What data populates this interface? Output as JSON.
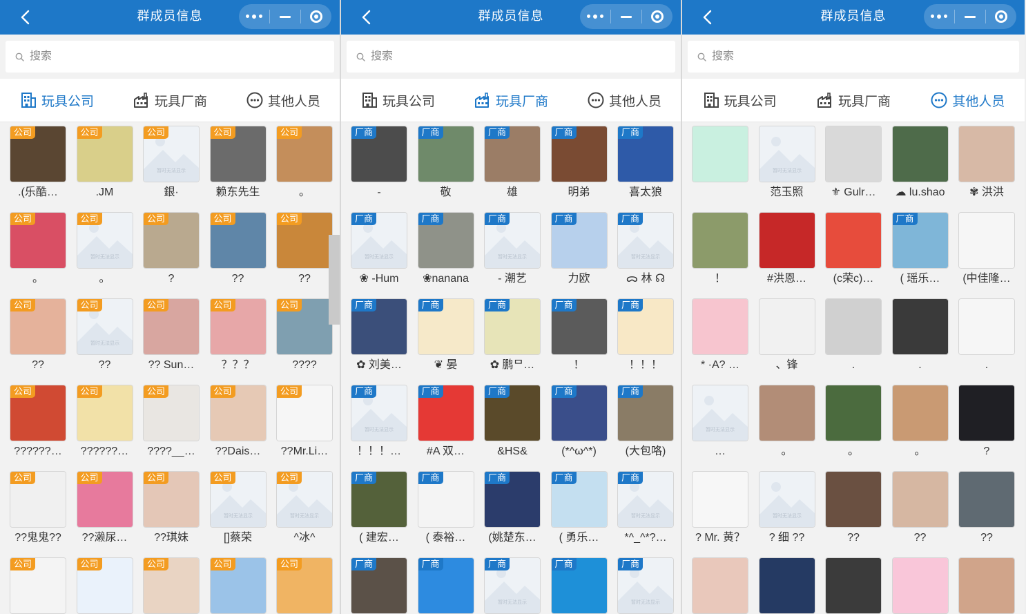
{
  "screens": [
    {
      "title": "群成员信息",
      "search_placeholder": "搜索",
      "tabs": [
        "玩具公司",
        "玩具厂商",
        "其他人员"
      ],
      "active_tab": 0,
      "badge_label": "公司",
      "members": [
        {
          "name": ".(乐酷…",
          "color": "#5a4632"
        },
        {
          "name": ".JM",
          "color": "#d9cf8a"
        },
        {
          "name": "銀·",
          "color": "",
          "placeholder": true
        },
        {
          "name": "赖东先生",
          "color": "#6b6b6b"
        },
        {
          "name": "。",
          "color": "#c48e5b"
        },
        {
          "name": "。",
          "color": "#d94f64"
        },
        {
          "name": "。",
          "color": "",
          "placeholder": true
        },
        {
          "name": "?",
          "color": "#b9a98f"
        },
        {
          "name": "??",
          "color": "#5f86a8"
        },
        {
          "name": "??",
          "color": "#c9873a"
        },
        {
          "name": "??",
          "color": "#e5b29b"
        },
        {
          "name": "??",
          "color": "",
          "placeholder": true
        },
        {
          "name": "?? Sun…",
          "color": "#d8a6a0"
        },
        {
          "name": "？？？",
          "color": "#e7a7a8"
        },
        {
          "name": "????",
          "color": "#7f9fb0"
        },
        {
          "name": "??????…",
          "color": "#d04a33"
        },
        {
          "name": "??????…",
          "color": "#f2e1a8"
        },
        {
          "name": "????__…",
          "color": "#e9e6e2"
        },
        {
          "name": "??Dais…",
          "color": "#e6c9b5"
        },
        {
          "name": "??Mr.Li…",
          "color": "#f6f6f6"
        },
        {
          "name": "??鬼鬼??",
          "color": "#f0f0f0"
        },
        {
          "name": "??濑尿…",
          "color": "#e77a9d"
        },
        {
          "name": "??琪妹",
          "color": "#e4c7b7"
        },
        {
          "name": "[]蔡荣",
          "color": "",
          "placeholder": true
        },
        {
          "name": "^冰^",
          "color": "",
          "placeholder": true
        },
        {
          "name": "",
          "color": "#f4f4f4"
        },
        {
          "name": "",
          "color": "#eaf2fb"
        },
        {
          "name": "",
          "color": "#e9d4c3"
        },
        {
          "name": "",
          "color": "#9bc3e8"
        },
        {
          "name": "",
          "color": "#f0b463"
        }
      ]
    },
    {
      "title": "群成员信息",
      "search_placeholder": "搜索",
      "tabs": [
        "玩具公司",
        "玩具厂商",
        "其他人员"
      ],
      "active_tab": 1,
      "badge_label": "厂商",
      "members": [
        {
          "name": "-",
          "color": "#4c4c4c"
        },
        {
          "name": "敬",
          "color": "#6f8a6a"
        },
        {
          "name": "雄",
          "color": "#9b7d66"
        },
        {
          "name": "明弟",
          "color": "#7a4b33"
        },
        {
          "name": "喜太狼",
          "color": "#2e5aa8"
        },
        {
          "name": "❀ -Hum",
          "color": "",
          "placeholder": true
        },
        {
          "name": "❀nanana",
          "color": "#8f9289"
        },
        {
          "name": "- 潮艺",
          "color": "",
          "placeholder": true
        },
        {
          "name": "力欧",
          "color": "#b7d0ec"
        },
        {
          "name": "ᯅ 林 ☊",
          "color": "",
          "placeholder": true
        },
        {
          "name": "✿ 刘美…",
          "color": "#3b4f7a"
        },
        {
          "name": "❦ 晏",
          "color": "#f6e9c9"
        },
        {
          "name": "✿ 鹏ᄆ…",
          "color": "#e7e4b8"
        },
        {
          "name": "！",
          "color": "#5b5b5b"
        },
        {
          "name": "！！！",
          "color": "#f8e8c6"
        },
        {
          "name": "！！！…",
          "color": "",
          "placeholder": true
        },
        {
          "name": "#A 双…",
          "color": "#e53935"
        },
        {
          "name": "&HS&",
          "color": "#5a4a2a"
        },
        {
          "name": "(*^ω^*)",
          "color": "#3a4e8a"
        },
        {
          "name": "(大包咯)",
          "color": "#8a7c66"
        },
        {
          "name": "( 建宏…",
          "color": "#54613a"
        },
        {
          "name": "( 泰裕…",
          "color": "#f4f4f4"
        },
        {
          "name": "(姚楚东…",
          "color": "#2b3c6b"
        },
        {
          "name": "( 勇乐…",
          "color": "#c4dff0"
        },
        {
          "name": "*^_^*?…",
          "color": "",
          "placeholder": true
        },
        {
          "name": "",
          "color": "#5b5148"
        },
        {
          "name": "",
          "color": "#2d8be0"
        },
        {
          "name": "",
          "color": "",
          "placeholder": true
        },
        {
          "name": "",
          "color": "#1e90d8"
        },
        {
          "name": "",
          "color": "",
          "placeholder": true
        }
      ]
    },
    {
      "title": "群成员信息",
      "search_placeholder": "搜索",
      "tabs": [
        "玩具公司",
        "玩具厂商",
        "其他人员"
      ],
      "active_tab": 2,
      "badge_label": "厂商",
      "members": [
        {
          "name": "",
          "color": "#c9f0e0"
        },
        {
          "name": "范玉照",
          "color": "",
          "placeholder": true
        },
        {
          "name": "⚜ Gulr…",
          "color": "#d9d9d9"
        },
        {
          "name": "☁ lu.shao",
          "color": "#4e6b4a"
        },
        {
          "name": "✾ 洪洪",
          "color": "#d7b9a6"
        },
        {
          "name": "！",
          "color": "#8c9b6a"
        },
        {
          "name": "#洪恩…",
          "color": "#c62828"
        },
        {
          "name": "(ᴄ荣ᴄ)…",
          "color": "#e74c3c"
        },
        {
          "name": "( 瑶乐…",
          "color": "#7fb6d8",
          "badge": true
        },
        {
          "name": "(中佳隆…",
          "color": "#f6f6f6"
        },
        {
          "name": "* ·A? …",
          "color": "#f7c5cf"
        },
        {
          "name": "、锋",
          "color": "#f1f1f1"
        },
        {
          "name": ".",
          "color": "#d0d0d0"
        },
        {
          "name": ".",
          "color": "#3a3a3a"
        },
        {
          "name": ".",
          "color": "#f6f6f6"
        },
        {
          "name": "…",
          "color": "",
          "placeholder": true
        },
        {
          "name": "。",
          "color": "#b28d77"
        },
        {
          "name": "。",
          "color": "#4b6b3e"
        },
        {
          "name": "。",
          "color": "#c99a73"
        },
        {
          "name": "?",
          "color": "#1f1f24"
        },
        {
          "name": "? Mr. 黄？",
          "color": "#f7f7f7"
        },
        {
          "name": "? 细 ??",
          "color": "",
          "placeholder": true
        },
        {
          "name": "??",
          "color": "#6a5041"
        },
        {
          "name": "??",
          "color": "#d6b7a2"
        },
        {
          "name": "??",
          "color": "#5f6a72"
        },
        {
          "name": "",
          "color": "#e9c8bb"
        },
        {
          "name": "",
          "color": "#253a63"
        },
        {
          "name": "",
          "color": "#3b3b3b"
        },
        {
          "name": "",
          "color": "#f9c6d9"
        },
        {
          "name": "",
          "color": "#d0a48a"
        }
      ]
    }
  ]
}
